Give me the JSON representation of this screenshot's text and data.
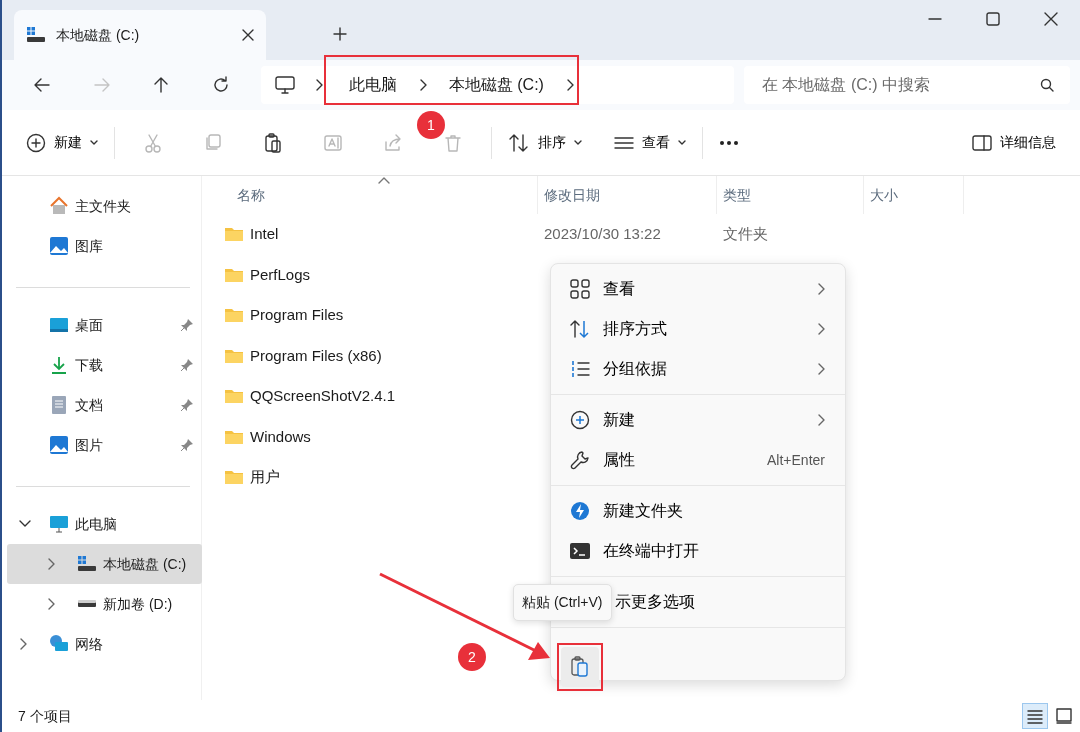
{
  "tab": {
    "title": "本地磁盘 (C:)"
  },
  "nav_buttons": [
    {
      "disabled": false
    },
    {
      "disabled": true
    },
    {
      "disabled": false
    },
    {
      "disabled": false
    }
  ],
  "address": {
    "segments": [
      "此电脑",
      "本地磁盘 (C:)"
    ]
  },
  "search": {
    "placeholder": "在 本地磁盘 (C:) 中搜索"
  },
  "toolbar": {
    "new_label": "新建",
    "icon_buttons": [
      {
        "disabled": true
      },
      {
        "disabled": true
      },
      {
        "disabled": false
      },
      {
        "disabled": true
      },
      {
        "disabled": true
      },
      {
        "disabled": true
      }
    ],
    "sort_label": "排序",
    "view_label": "查看",
    "details_label": "详细信息"
  },
  "sidebar": {
    "groups": [
      {
        "items": [
          {
            "label": "主文件夹",
            "pinned": false
          },
          {
            "label": "图库",
            "pinned": false
          }
        ]
      },
      {
        "items": [
          {
            "label": "桌面",
            "pinned": true
          },
          {
            "label": "下载",
            "pinned": true
          },
          {
            "label": "文档",
            "pinned": true
          },
          {
            "label": "图片",
            "pinned": true
          }
        ]
      }
    ],
    "tree": [
      {
        "label": "此电脑",
        "expanded": true,
        "selected": false,
        "children": [
          {
            "label": "本地磁盘 (C:)",
            "expanded": false,
            "selected": true
          },
          {
            "label": "新加卷 (D:)",
            "expanded": false,
            "selected": false
          }
        ]
      },
      {
        "label": "网络",
        "expanded": false,
        "selected": false
      }
    ]
  },
  "table": {
    "columns": [
      {
        "label": "名称",
        "sorted": true
      },
      {
        "label": "修改日期",
        "sorted": false
      },
      {
        "label": "类型",
        "sorted": false
      },
      {
        "label": "大小",
        "sorted": false
      }
    ],
    "rows": [
      {
        "name": "Intel",
        "date": "2023/10/30 13:22",
        "type": "文件夹"
      },
      {
        "name": "PerfLogs"
      },
      {
        "name": "Program Files"
      },
      {
        "name": "Program Files (x86)"
      },
      {
        "name": "QQScreenShotV2.4.1"
      },
      {
        "name": "Windows"
      },
      {
        "name": "用户"
      }
    ]
  },
  "context_menu": {
    "groups": [
      {
        "items": [
          {
            "label": "查看",
            "submenu": true
          },
          {
            "label": "排序方式",
            "submenu": true
          },
          {
            "label": "分组依据",
            "submenu": true
          }
        ]
      },
      {
        "items": [
          {
            "label": "新建",
            "submenu": true
          },
          {
            "label": "属性",
            "submenu": false,
            "shortcut": "Alt+Enter"
          }
        ]
      },
      {
        "items": [
          {
            "label": "新建文件夹",
            "submenu": false
          },
          {
            "label": "在终端中打开",
            "submenu": false
          }
        ]
      },
      {
        "items": [
          {
            "label": "示更多选项",
            "submenu": false
          }
        ]
      }
    ]
  },
  "tooltip": {
    "text": "粘贴 (Ctrl+V)"
  },
  "status_bar": {
    "count": "7 个项目",
    "view_buttons": [
      {
        "selected": true
      },
      {
        "selected": false
      }
    ]
  },
  "annotations": [
    {
      "label": "1"
    },
    {
      "label": "2"
    }
  ]
}
